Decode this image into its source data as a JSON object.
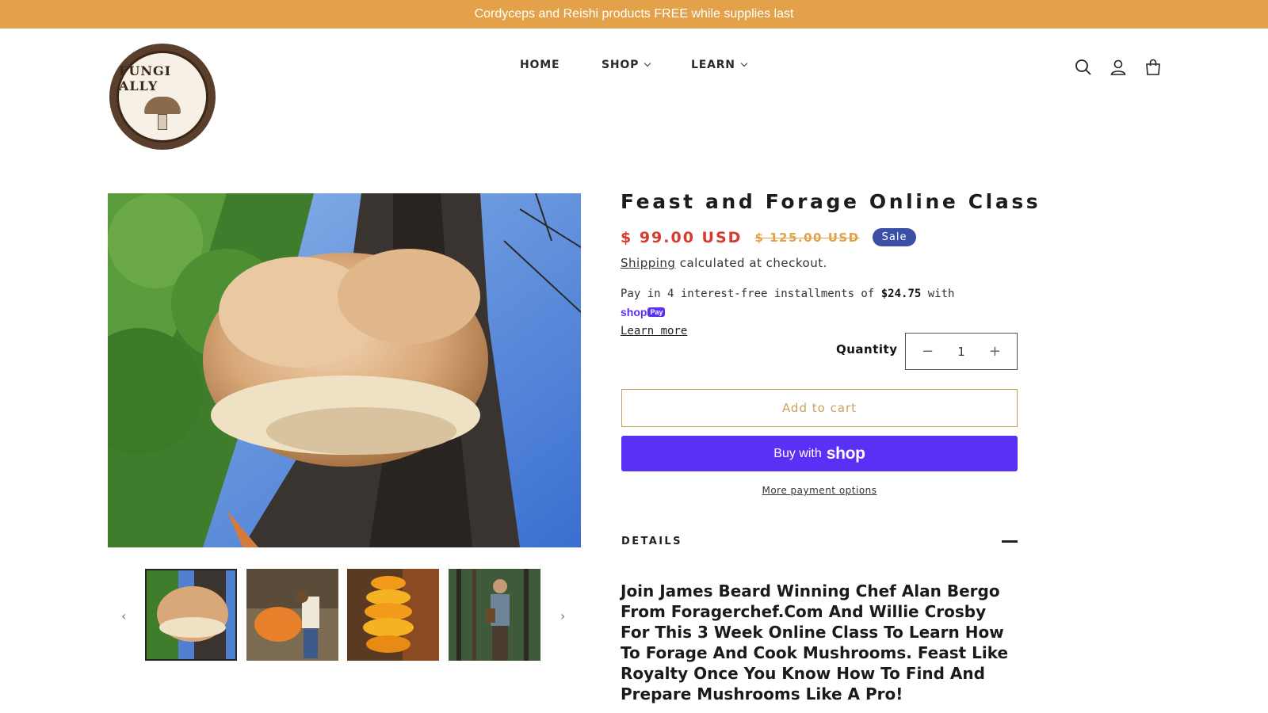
{
  "announcement": "Cordyceps and Reishi products FREE while supplies last",
  "logo": {
    "text": "FUNGI ALLY"
  },
  "nav": {
    "items": [
      {
        "label": "HOME",
        "dropdown": false
      },
      {
        "label": "SHOP",
        "dropdown": true
      },
      {
        "label": "LEARN",
        "dropdown": true
      }
    ]
  },
  "header_icons": [
    "search-icon",
    "account-icon",
    "cart-icon"
  ],
  "product": {
    "title": "Feast and Forage Online Class",
    "price_sale": "$ 99.00 USD",
    "price_regular": "$ 125.00 USD",
    "badge": "Sale",
    "shipping_link": "Shipping",
    "shipping_text": " calculated at checkout.",
    "installments": {
      "prefix": "Pay in 4 interest-free installments of ",
      "amount": "$24.75",
      "suffix": " with ",
      "brand": "shop",
      "brand_tag": "Pay",
      "learn_more": "Learn more"
    },
    "quantity_label": "Quantity",
    "quantity": "1",
    "qty_minus": "−",
    "qty_plus": "+",
    "add_to_cart": "Add to cart",
    "buy_with": "Buy with",
    "buy_brand": "shop",
    "more_payment": "More payment options",
    "details_label": "DETAILS",
    "description": "Join James Beard Winning Chef Alan Bergo From Foragerchef.Com And Willie Crosby For This 3 Week Online Class To Learn How To Forage And Cook Mushrooms. Feast Like Royalty Once You Know How To Find And Prepare Mushrooms Like A Pro!"
  },
  "gallery": {
    "prev": "‹",
    "next": "›",
    "thumbnails": [
      "oyster-mushroom-tree",
      "person-harvesting",
      "orange-shelf-fungi",
      "forager-in-forest"
    ]
  },
  "colors": {
    "announcement": "#e3a24a",
    "sale": "#d63b2e",
    "badge": "#3b4fa6",
    "shop_pay": "#5a31f4"
  }
}
